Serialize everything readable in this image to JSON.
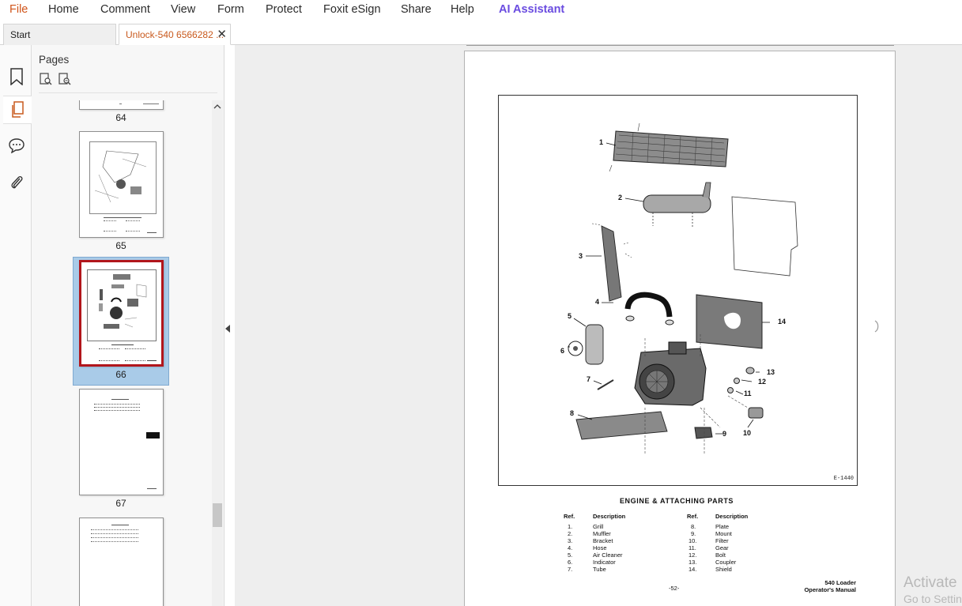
{
  "menu": {
    "file": "File",
    "home": "Home",
    "comment": "Comment",
    "view": "View",
    "form": "Form",
    "protect": "Protect",
    "esign": "Foxit eSign",
    "share": "Share",
    "help": "Help",
    "ai": "AI Assistant"
  },
  "tabs": {
    "start": "Start",
    "doc": "Unlock-540 6566282 ...",
    "close": "✕"
  },
  "rail": {
    "icons": [
      "bookmark-icon",
      "pages-icon",
      "comment-icon",
      "attachment-icon"
    ]
  },
  "pages_panel": {
    "title": "Pages",
    "thumbnails": [
      {
        "label": "64"
      },
      {
        "label": "65"
      },
      {
        "label": "66",
        "selected": true
      },
      {
        "label": "67"
      }
    ]
  },
  "document": {
    "figure_code": "E-1440",
    "callouts": [
      "1",
      "2",
      "3",
      "4",
      "5",
      "6",
      "7",
      "8",
      "9",
      "10",
      "11",
      "12",
      "13",
      "14"
    ],
    "caption": "ENGINE & ATTACHING PARTS",
    "table_headers": {
      "ref": "Ref.",
      "desc": "Description"
    },
    "parts_left": [
      {
        "ref": "1.",
        "desc": "Grill"
      },
      {
        "ref": "2.",
        "desc": "Muffler"
      },
      {
        "ref": "3.",
        "desc": "Bracket"
      },
      {
        "ref": "4.",
        "desc": "Hose"
      },
      {
        "ref": "5.",
        "desc": "Air Cleaner"
      },
      {
        "ref": "6.",
        "desc": "Indicator"
      },
      {
        "ref": "7.",
        "desc": "Tube"
      }
    ],
    "parts_right": [
      {
        "ref": "8.",
        "desc": "Plate"
      },
      {
        "ref": "9.",
        "desc": "Mount"
      },
      {
        "ref": "10.",
        "desc": "Filter"
      },
      {
        "ref": "11.",
        "desc": "Gear"
      },
      {
        "ref": "12.",
        "desc": "Bolt"
      },
      {
        "ref": "13.",
        "desc": "Coupler"
      },
      {
        "ref": "14.",
        "desc": "Shield"
      }
    ],
    "page_number": "-52-",
    "footer_line1": "540 Loader",
    "footer_line2": "Operator's Manual"
  },
  "watermark": {
    "line1": "Activate",
    "line2": "Go to Settings"
  },
  "colors": {
    "file_menu": "#d0541a",
    "ai_menu": "#6a4ce0",
    "doc_tab": "#c95a1e",
    "selected_thumb": "#a9cbe8",
    "thumb_border": "#b1161c"
  }
}
